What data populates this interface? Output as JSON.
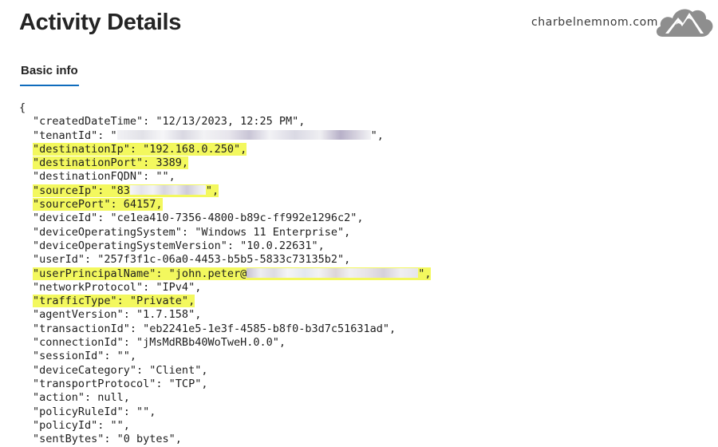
{
  "header": {
    "title": "Activity Details",
    "watermark": "charbelnemnom.com"
  },
  "tabs": {
    "active": "Basic info"
  },
  "json_view": {
    "open_brace": "{",
    "lines": [
      {
        "text": "\"createdDateTime\": \"12/13/2023, 12:25 PM\","
      },
      {
        "before": "\"tenantId\": \"",
        "redacted": true,
        "after": "\","
      },
      {
        "text": "\"destinationIp\": \"192.168.0.250\",",
        "highlight": true
      },
      {
        "text": "\"destinationPort\": 3389,",
        "highlight": true
      },
      {
        "text": "\"destinationFQDN\": \"\","
      },
      {
        "before": "\"sourceIp\": \"83",
        "redacted": true,
        "after": "\",",
        "highlight": true
      },
      {
        "text": "\"sourcePort\": 64157,",
        "highlight": true
      },
      {
        "text": "\"deviceId\": \"ce1ea410-7356-4800-b89c-ff992e1296c2\","
      },
      {
        "text": "\"deviceOperatingSystem\": \"Windows 11 Enterprise\","
      },
      {
        "text": "\"deviceOperatingSystemVersion\": \"10.0.22631\","
      },
      {
        "text": "\"userId\": \"257f3f1c-06a0-4453-b5b5-5833c73135b2\","
      },
      {
        "before": "\"userPrincipalName\": \"john.peter@",
        "redacted": true,
        "after": "\",",
        "highlight": true
      },
      {
        "text": "\"networkProtocol\": \"IPv4\","
      },
      {
        "text": "\"trafficType\": \"Private\",",
        "highlight": true
      },
      {
        "text": "\"agentVersion\": \"1.7.158\","
      },
      {
        "text": "\"transactionId\": \"eb2241e5-1e3f-4585-b8f0-b3d7c51631ad\","
      },
      {
        "text": "\"connectionId\": \"jMsMdRBb40WoTweH.0.0\","
      },
      {
        "text": "\"sessionId\": \"\","
      },
      {
        "text": "\"deviceCategory\": \"Client\","
      },
      {
        "text": "\"transportProtocol\": \"TCP\","
      },
      {
        "text": "\"action\": null,"
      },
      {
        "text": "\"policyRuleId\": \"\","
      },
      {
        "text": "\"policyId\": \"\","
      },
      {
        "text": "\"sentBytes\": \"0 bytes\","
      }
    ]
  }
}
